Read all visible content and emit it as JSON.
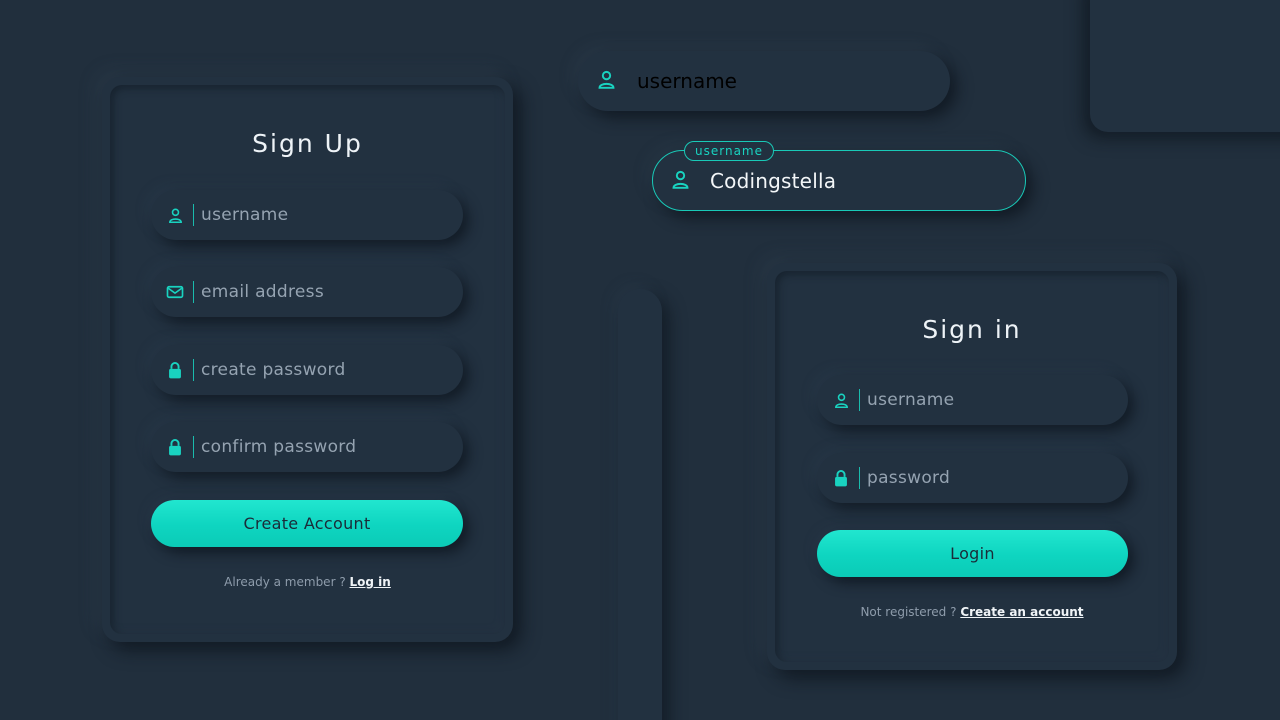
{
  "colors": {
    "background": "#212f3d",
    "surface": "#223140",
    "accent": "#19d3c0",
    "placeholder": "#95a3b1",
    "title": "#eef3f7",
    "button_text": "#1b2b38"
  },
  "demo": {
    "plain_field": {
      "icon": "user-icon",
      "placeholder": "username"
    },
    "active_field": {
      "icon": "user-icon",
      "floating_label": "username",
      "value": "Codingstella"
    }
  },
  "signup": {
    "title": "Sign Up",
    "fields": [
      {
        "icon": "user-icon",
        "placeholder": "username"
      },
      {
        "icon": "mail-icon",
        "placeholder": "email address"
      },
      {
        "icon": "lock-icon",
        "placeholder": "create password"
      },
      {
        "icon": "lock-icon",
        "placeholder": "confirm password"
      }
    ],
    "button_label": "Create Account",
    "footer_text": "Already a member ?",
    "footer_link": "Log in"
  },
  "signin": {
    "title": "Sign in",
    "fields": [
      {
        "icon": "user-icon",
        "placeholder": "username"
      },
      {
        "icon": "lock-icon",
        "placeholder": "password"
      }
    ],
    "button_label": "Login",
    "footer_text": "Not registered ?",
    "footer_link": "Create an account"
  }
}
